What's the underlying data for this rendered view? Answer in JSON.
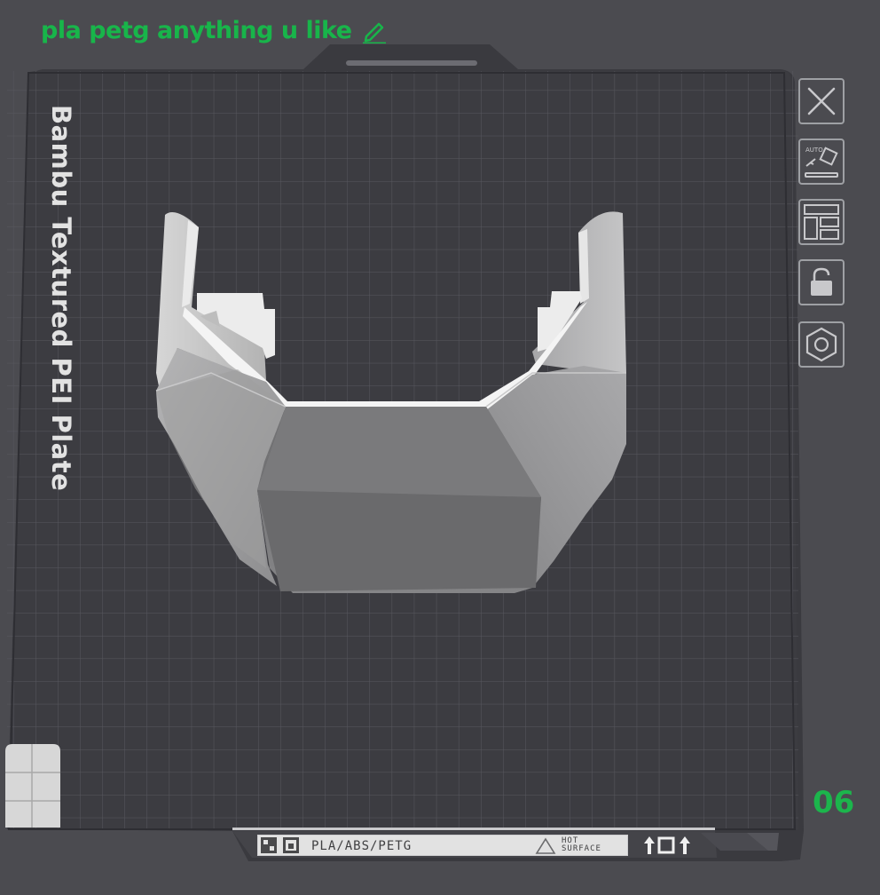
{
  "plate": {
    "title": "pla petg anything u like",
    "name": "Bambu Textured PEI Plate",
    "number": "06",
    "label_strip": {
      "filaments": "PLA/ABS/PETG",
      "hot_line1": "HOT",
      "hot_line2": "SURFACE"
    }
  },
  "toolbar": {
    "buttons": [
      "close",
      "auto-orient",
      "arrange",
      "lock",
      "settings"
    ],
    "auto_label": "AUTO"
  },
  "icons": {
    "edit": "pencil-icon",
    "close": "close-icon",
    "auto_orient": "auto-orient-icon",
    "arrange": "arrange-icon",
    "lock": "lock-icon",
    "settings": "hex-nut-icon"
  },
  "colors": {
    "background": "#4b4b50",
    "plate": "#3a3a3f",
    "accent_green": "#18b54a",
    "model": "#cfcfcf"
  }
}
